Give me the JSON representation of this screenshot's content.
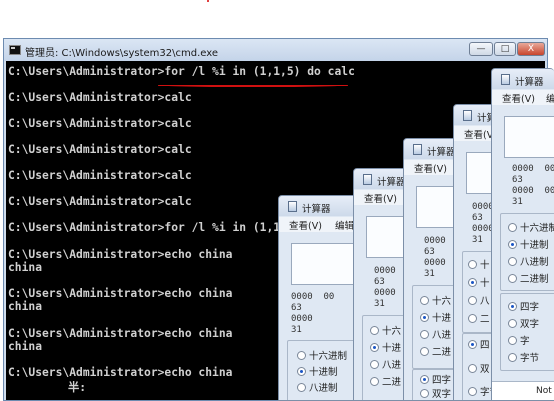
{
  "cmd": {
    "title": "管理员: C:\\Windows\\system32\\cmd.exe",
    "buttons": {
      "minimize": "—",
      "maximize": "□",
      "close": "X"
    },
    "lines": [
      "C:\\Users\\Administrator>for /l %i in (1,1,5) do calc",
      "C:\\Users\\Administrator>calc",
      "C:\\Users\\Administrator>calc",
      "C:\\Users\\Administrator>calc",
      "C:\\Users\\Administrator>calc",
      "C:\\Users\\Administrator>calc",
      "C:\\Users\\Administrator>for /l %i in (1,1,5",
      "C:\\Users\\Administrator>echo china",
      "china",
      "C:\\Users\\Administrator>echo china",
      "china",
      "C:\\Users\\Administrator>echo china",
      "china",
      "C:\\Users\\Administrator>echo china",
      "半:"
    ]
  },
  "calculators": [
    {
      "title": "计算器",
      "menu": [
        "查看(V)",
        "编辑"
      ],
      "bits": [
        "0000  00",
        "63",
        "0000",
        "31"
      ],
      "radios": [
        "十六进制",
        "十进制",
        "八进制",
        "二进制"
      ],
      "selected": 1
    },
    {
      "title": "计算器",
      "menu": [
        "查看(V)"
      ],
      "bits": [
        "0000",
        "63",
        "0000",
        "31"
      ],
      "radios": [
        "十六",
        "十进",
        "八进",
        "二进"
      ],
      "selected": 1
    },
    {
      "title": "计算器",
      "menu": [
        "查看(V)"
      ],
      "bits": [
        "0000",
        "63",
        "0000",
        "31"
      ],
      "radios": [
        "十六",
        "十进",
        "八进",
        "二进"
      ],
      "radios2": [
        "四字",
        "双字"
      ],
      "selected": 1
    },
    {
      "title": "计算器",
      "menu": [
        "查看(V)"
      ],
      "bits": [
        "0000",
        "63",
        "0000",
        "31"
      ],
      "radios": [
        "十",
        "十",
        "八",
        "二"
      ],
      "radios2": [
        "四",
        "双",
        "字节"
      ],
      "selected": 1
    },
    {
      "title": "计算器",
      "menu": [
        "查看(V)",
        "编"
      ],
      "bits": [
        "0000  00",
        "63",
        "0000  00",
        "31"
      ],
      "radios": [
        "十六进制",
        "十进制",
        "八进制",
        "二进制"
      ],
      "radios2": [
        "四字",
        "双字",
        "字",
        "字节"
      ],
      "selected": 1,
      "selected2": 0,
      "status": "Not"
    }
  ]
}
